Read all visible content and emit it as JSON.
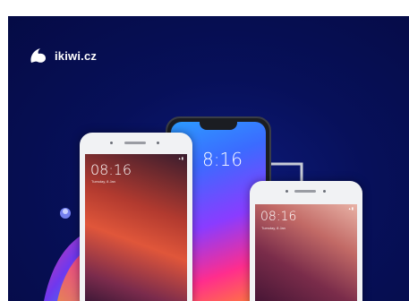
{
  "brand": {
    "name": "ikiwi.cz"
  },
  "phones": {
    "left": {
      "time": "08:16",
      "date": "Tuesday, 8 Jan"
    },
    "center": {
      "time": "8:16"
    },
    "right": {
      "time": "08:16",
      "date": "Tuesday, 8 Jan"
    }
  },
  "colors": {
    "background": "#07105a",
    "phone_white": "#f1f2f4",
    "phone_black": "#1b1d22"
  }
}
